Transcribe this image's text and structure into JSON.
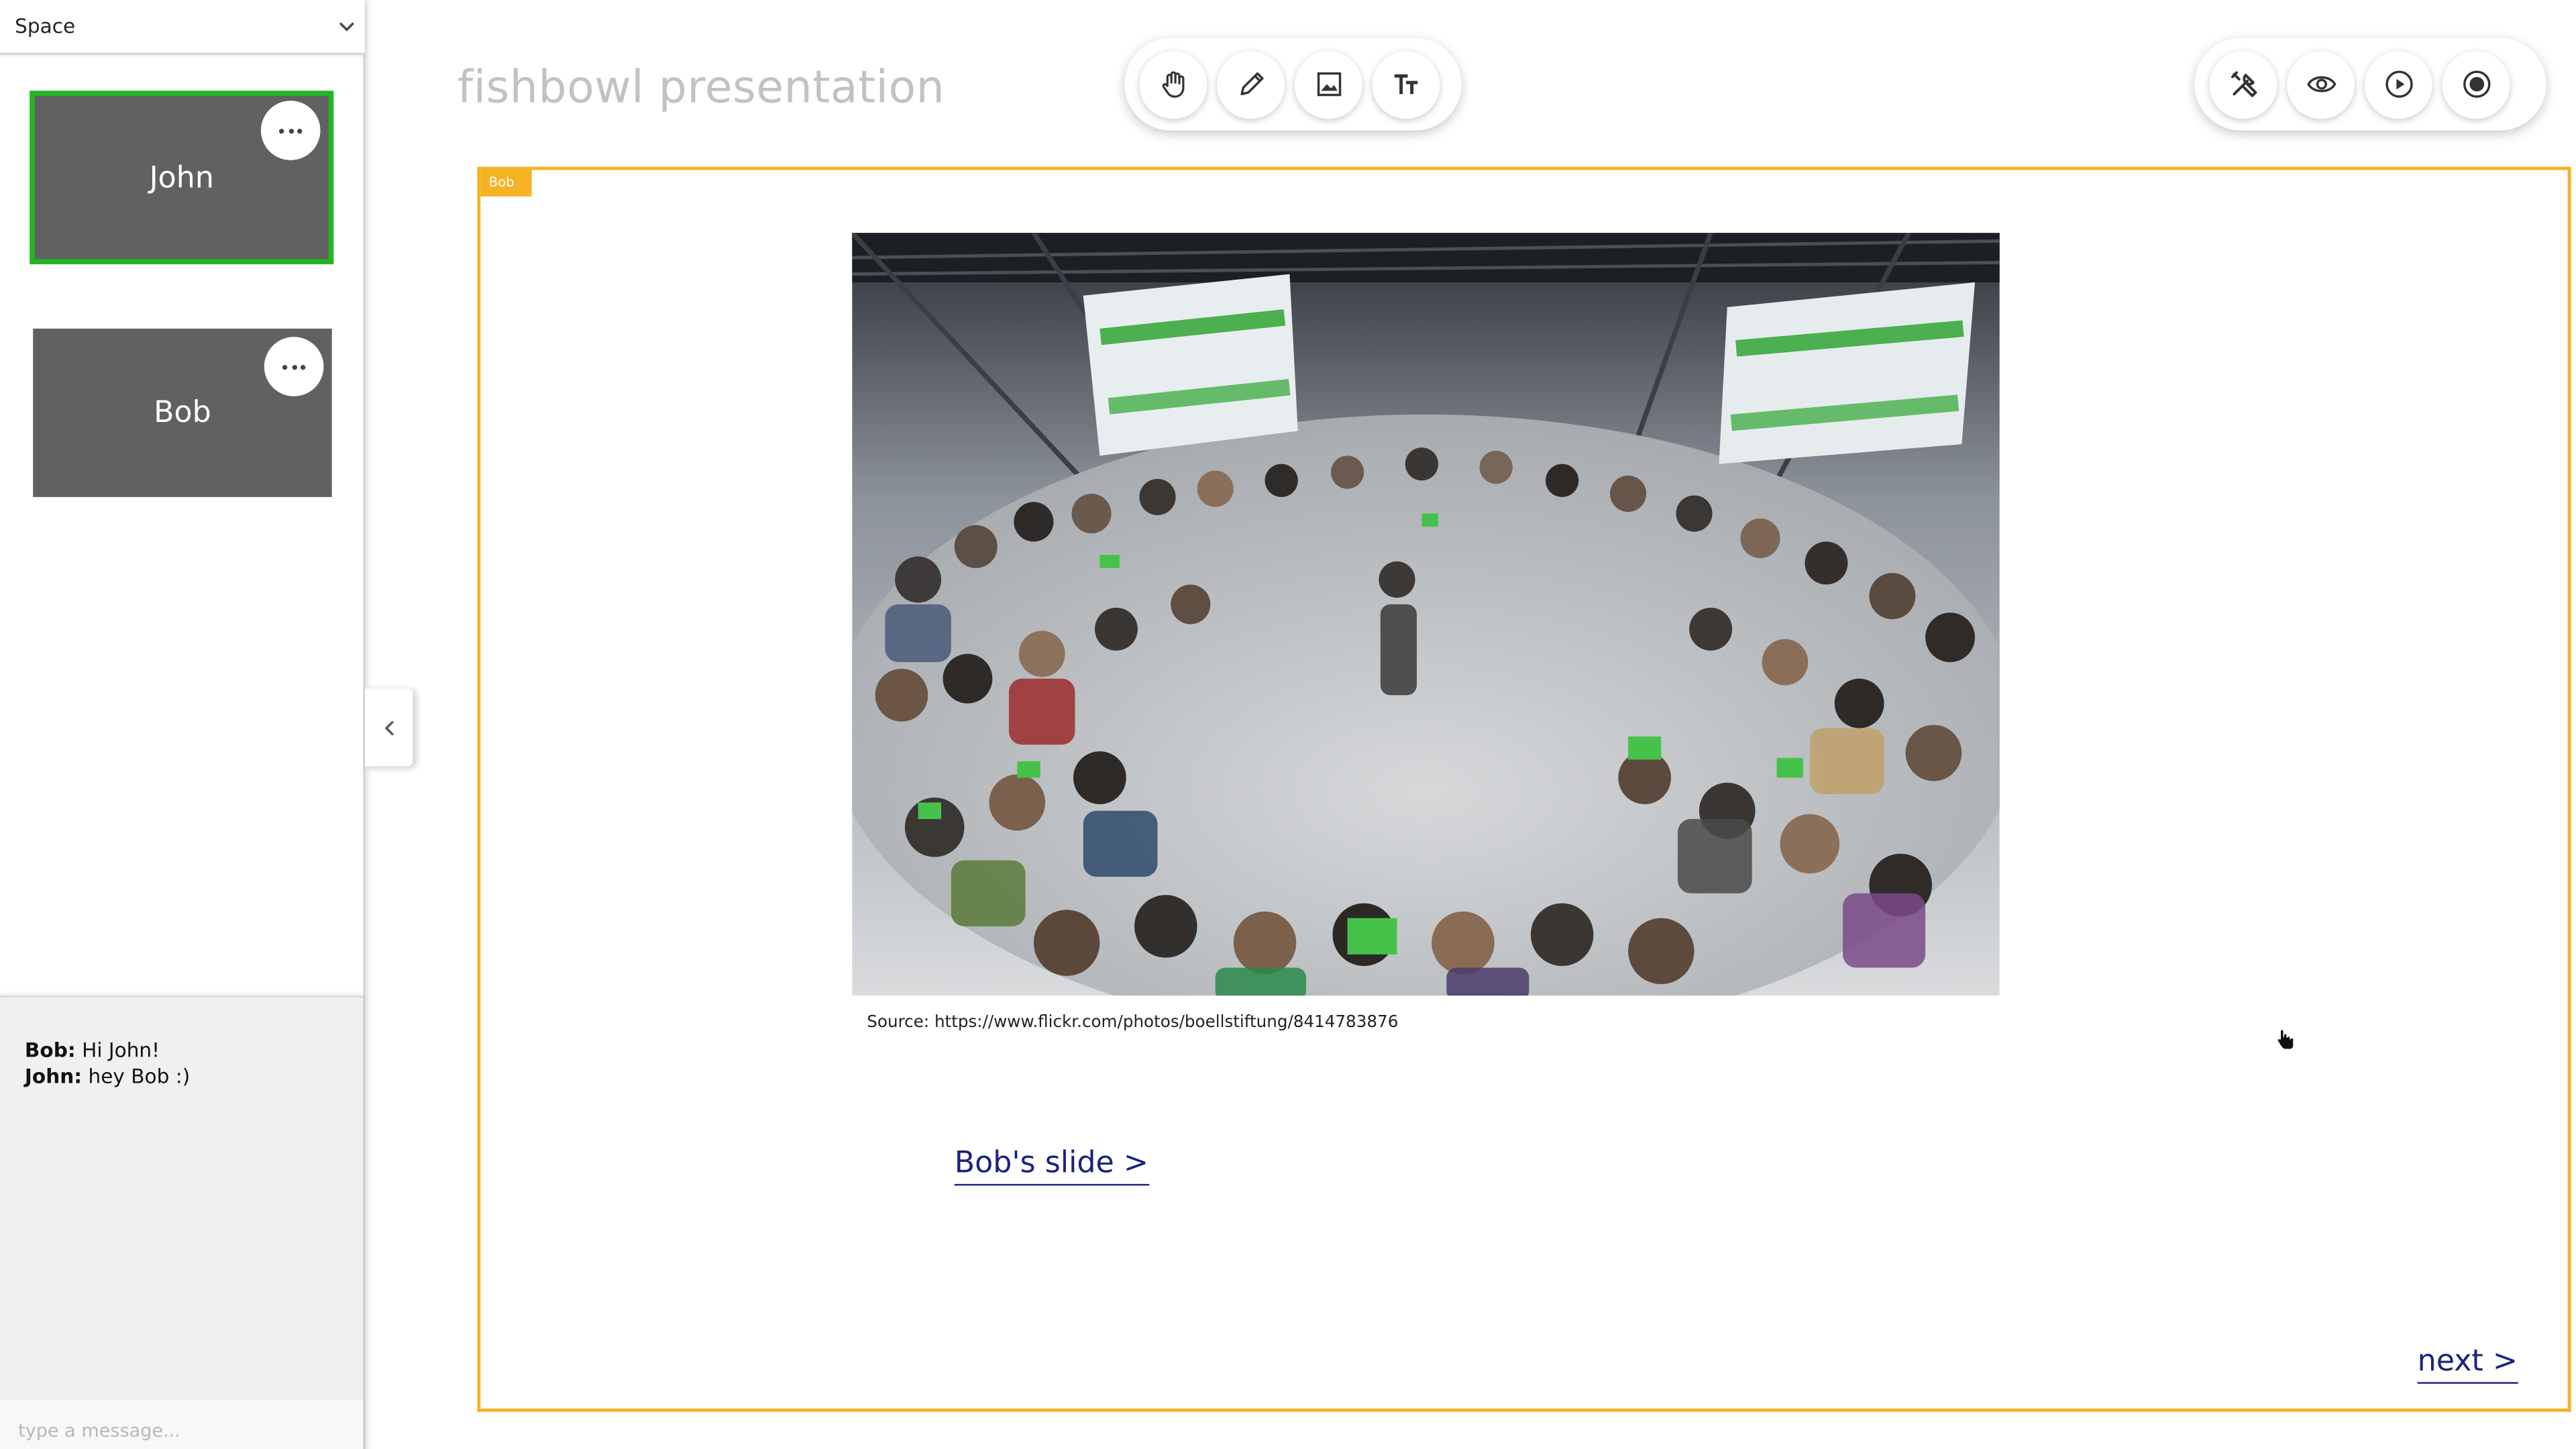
{
  "sidebar": {
    "space_label": "Space",
    "tiles": [
      {
        "name": "John",
        "active": true
      },
      {
        "name": "Bob",
        "active": false
      }
    ]
  },
  "chat": {
    "messages": [
      {
        "author": "Bob:",
        "text": "Hi John!"
      },
      {
        "author": "John:",
        "text": "hey Bob :)"
      }
    ],
    "input_placeholder": "type a message..."
  },
  "presentation": {
    "title": "fishbowl presentation",
    "frame_label": "Bob",
    "source_text": "Source: https://www.flickr.com/photos/boellstiftung/8414783876",
    "bob_slide_link": "Bob's slide >",
    "next_link": "next >"
  },
  "toolbar_left": [
    "hand-icon",
    "pencil-icon",
    "image-icon",
    "text-icon"
  ],
  "toolbar_right": [
    "tools-icon",
    "eye-icon",
    "play-icon",
    "record-icon"
  ],
  "colors": {
    "frame_accent": "#f5b323",
    "active_tile_border": "#1fb81f",
    "link": "#1a237e",
    "tile_bg": "#616161"
  }
}
